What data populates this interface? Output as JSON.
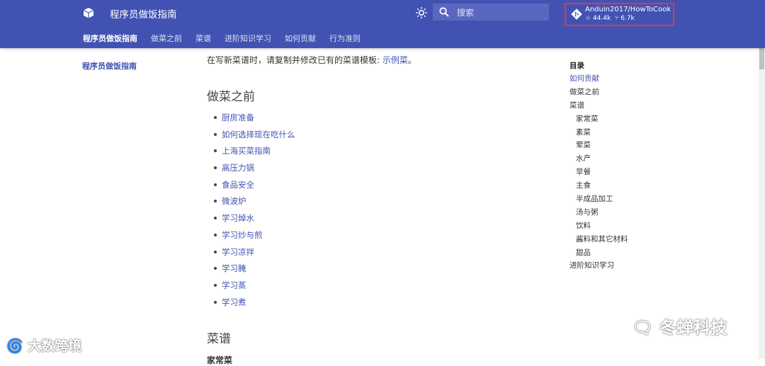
{
  "header": {
    "site_title": "程序员做饭指南",
    "search_placeholder": "搜索",
    "repo": {
      "name": "Anduin2017/HowToCook",
      "stars": "44.4k",
      "forks": "6.7k"
    },
    "tabs": [
      {
        "label": "程序员做饭指南",
        "active": true
      },
      {
        "label": "做菜之前"
      },
      {
        "label": "菜谱"
      },
      {
        "label": "进阶知识学习"
      },
      {
        "label": "如何贡献"
      },
      {
        "label": "行为准则"
      }
    ],
    "colors": {
      "primary": "#4152b3",
      "highlight": "#e53935"
    }
  },
  "left_nav": {
    "current": "程序员做饭指南"
  },
  "content": {
    "intro_text": "在写新菜谱时，请复制并修改已有的菜谱模板: ",
    "intro_link": "示例菜",
    "intro_end": "。",
    "section1_title": "做菜之前",
    "section1_links": [
      "厨房准备",
      "如何选择现在吃什么",
      "上海买菜指南",
      "高压力锅",
      "食品安全",
      "微波炉",
      "学习焯水",
      "学习炒与煎",
      "学习凉拌",
      "学习腌",
      "学习蒸",
      "学习煮"
    ],
    "section2_title": "菜谱",
    "section2_sub": "家常菜"
  },
  "toc": {
    "title": "目录",
    "items": [
      {
        "label": "如何贡献",
        "level": 1,
        "active": true
      },
      {
        "label": "做菜之前",
        "level": 1
      },
      {
        "label": "菜谱",
        "level": 1
      },
      {
        "label": "家常菜",
        "level": 2
      },
      {
        "label": "素菜",
        "level": 2
      },
      {
        "label": "荤菜",
        "level": 2
      },
      {
        "label": "水产",
        "level": 2
      },
      {
        "label": "早餐",
        "level": 2
      },
      {
        "label": "主食",
        "level": 2
      },
      {
        "label": "半成品加工",
        "level": 2
      },
      {
        "label": "汤与粥",
        "level": 2
      },
      {
        "label": "饮料",
        "level": 2
      },
      {
        "label": "酱料和其它材料",
        "level": 2
      },
      {
        "label": "甜品",
        "level": 2
      },
      {
        "label": "进阶知识学习",
        "level": 1
      }
    ]
  },
  "watermarks": {
    "left": "大数跨境",
    "right": "冬蝉科技"
  }
}
